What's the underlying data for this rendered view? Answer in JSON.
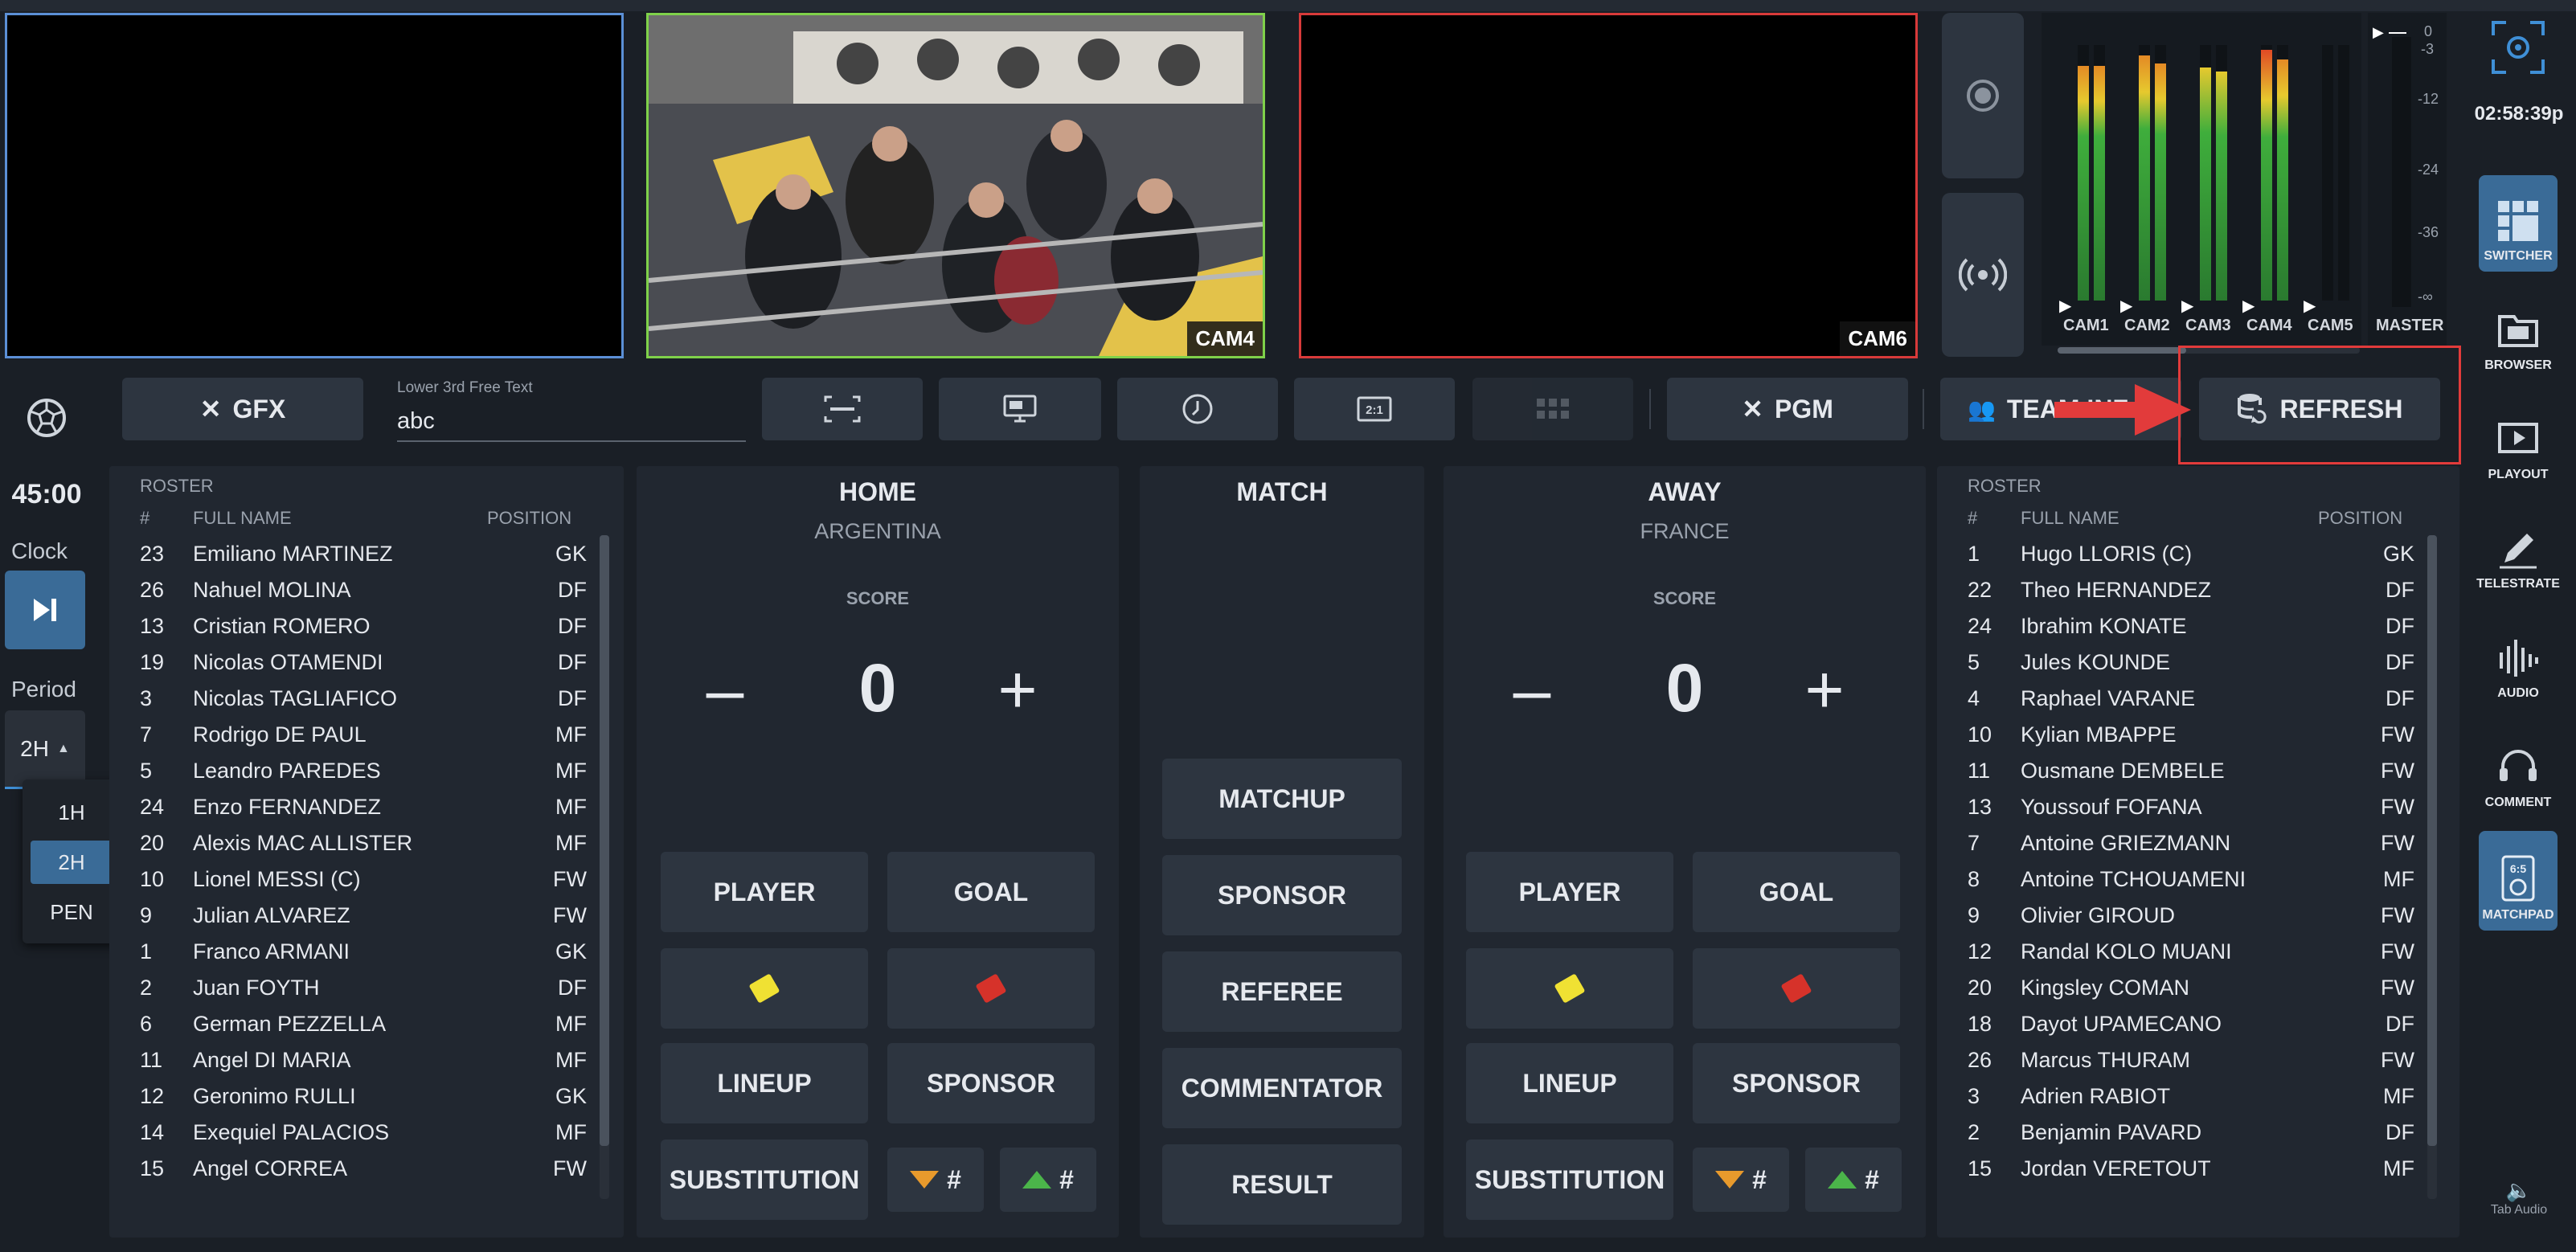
{
  "monitors": {
    "cam4_label": "CAM4",
    "cam6_label": "CAM6"
  },
  "audio": {
    "scale": [
      "0",
      "-3",
      "-12",
      "-24",
      "-36",
      "-∞"
    ],
    "channels": [
      "CAM1",
      "CAM2",
      "CAM3",
      "CAM4",
      "CAM5"
    ],
    "master_label": "MASTER"
  },
  "clock": {
    "time": "02:58:39p"
  },
  "sidebar_right": {
    "items": [
      {
        "label": "SWITCHER",
        "icon": "switcher-icon"
      },
      {
        "label": "BROWSER",
        "icon": "browser-icon"
      },
      {
        "label": "PLAYOUT",
        "icon": "playout-icon"
      },
      {
        "label": "TELESTRATE",
        "icon": "telestrate-icon"
      },
      {
        "label": "AUDIO",
        "icon": "audio-icon"
      },
      {
        "label": "COMMENT",
        "icon": "headset-icon"
      },
      {
        "label": "MATCHPAD",
        "icon": "matchpad-icon"
      }
    ],
    "tab_audio": "Tab Audio"
  },
  "sidebar_left": {
    "game_time": "45:00",
    "clock_label": "Clock",
    "period_label": "Period",
    "period_value": "2H",
    "period_options": [
      "1H",
      "2H",
      "PEN"
    ]
  },
  "toolbar": {
    "gfx_label": "GFX",
    "lower3rd_label": "Lower 3rd Free Text",
    "lower3rd_value": "abc",
    "pgm_label": "PGM",
    "team_label": "TEAM INF",
    "refresh_label": "REFRESH"
  },
  "home": {
    "title": "HOME",
    "country": "ARGENTINA",
    "score_label": "SCORE",
    "score": "0",
    "roster_label": "ROSTER",
    "col_num": "#",
    "col_name": "FULL NAME",
    "col_pos": "POSITION",
    "players": [
      {
        "num": "23",
        "name": "Emiliano MARTINEZ",
        "pos": "GK"
      },
      {
        "num": "26",
        "name": "Nahuel MOLINA",
        "pos": "DF"
      },
      {
        "num": "13",
        "name": "Cristian ROMERO",
        "pos": "DF"
      },
      {
        "num": "19",
        "name": "Nicolas OTAMENDI",
        "pos": "DF"
      },
      {
        "num": "3",
        "name": "Nicolas TAGLIAFICO",
        "pos": "DF"
      },
      {
        "num": "7",
        "name": "Rodrigo DE PAUL",
        "pos": "MF"
      },
      {
        "num": "5",
        "name": "Leandro PAREDES",
        "pos": "MF"
      },
      {
        "num": "24",
        "name": "Enzo FERNANDEZ",
        "pos": "MF"
      },
      {
        "num": "20",
        "name": "Alexis MAC ALLISTER",
        "pos": "MF"
      },
      {
        "num": "10",
        "name": "Lionel MESSI (C)",
        "pos": "FW"
      },
      {
        "num": "9",
        "name": "Julian ALVAREZ",
        "pos": "FW"
      },
      {
        "num": "1",
        "name": "Franco ARMANI",
        "pos": "GK"
      },
      {
        "num": "2",
        "name": "Juan FOYTH",
        "pos": "DF"
      },
      {
        "num": "6",
        "name": "German PEZZELLA",
        "pos": "MF"
      },
      {
        "num": "11",
        "name": "Angel DI MARIA",
        "pos": "MF"
      },
      {
        "num": "12",
        "name": "Geronimo RULLI",
        "pos": "GK"
      },
      {
        "num": "14",
        "name": "Exequiel PALACIOS",
        "pos": "MF"
      },
      {
        "num": "15",
        "name": "Angel CORREA",
        "pos": "FW"
      }
    ]
  },
  "away": {
    "title": "AWAY",
    "country": "FRANCE",
    "score_label": "SCORE",
    "score": "0",
    "roster_label": "ROSTER",
    "col_num": "#",
    "col_name": "FULL NAME",
    "col_pos": "POSITION",
    "players": [
      {
        "num": "1",
        "name": "Hugo LLORIS (C)",
        "pos": "GK"
      },
      {
        "num": "22",
        "name": "Theo HERNANDEZ",
        "pos": "DF"
      },
      {
        "num": "24",
        "name": "Ibrahim KONATE",
        "pos": "DF"
      },
      {
        "num": "5",
        "name": "Jules KOUNDE",
        "pos": "DF"
      },
      {
        "num": "4",
        "name": "Raphael VARANE",
        "pos": "DF"
      },
      {
        "num": "10",
        "name": "Kylian MBAPPE",
        "pos": "FW"
      },
      {
        "num": "11",
        "name": "Ousmane DEMBELE",
        "pos": "FW"
      },
      {
        "num": "13",
        "name": "Youssouf FOFANA",
        "pos": "FW"
      },
      {
        "num": "7",
        "name": "Antoine GRIEZMANN",
        "pos": "FW"
      },
      {
        "num": "8",
        "name": "Antoine TCHOUAMENI",
        "pos": "MF"
      },
      {
        "num": "9",
        "name": "Olivier GIROUD",
        "pos": "FW"
      },
      {
        "num": "12",
        "name": "Randal KOLO MUANI",
        "pos": "FW"
      },
      {
        "num": "20",
        "name": "Kingsley COMAN",
        "pos": "FW"
      },
      {
        "num": "18",
        "name": "Dayot UPAMECANO",
        "pos": "DF"
      },
      {
        "num": "26",
        "name": "Marcus THURAM",
        "pos": "FW"
      },
      {
        "num": "3",
        "name": "Adrien RABIOT",
        "pos": "MF"
      },
      {
        "num": "2",
        "name": "Benjamin PAVARD",
        "pos": "DF"
      },
      {
        "num": "15",
        "name": "Jordan VERETOUT",
        "pos": "MF"
      }
    ]
  },
  "actions": {
    "player": "PLAYER",
    "goal": "GOAL",
    "lineup": "LINEUP",
    "sponsor": "SPONSOR",
    "substitution": "SUBSTITUTION",
    "hash": "#"
  },
  "match": {
    "title": "MATCH",
    "buttons": [
      "MATCHUP",
      "SPONSOR",
      "REFEREE",
      "COMMENTATOR",
      "RESULT"
    ]
  },
  "colors": {
    "accent": "#3a6b97",
    "highlight_red": "#e23b3b",
    "preview_border": "#5b8fd6",
    "live_border": "#7fd14a",
    "program_border": "#d83a3a"
  }
}
